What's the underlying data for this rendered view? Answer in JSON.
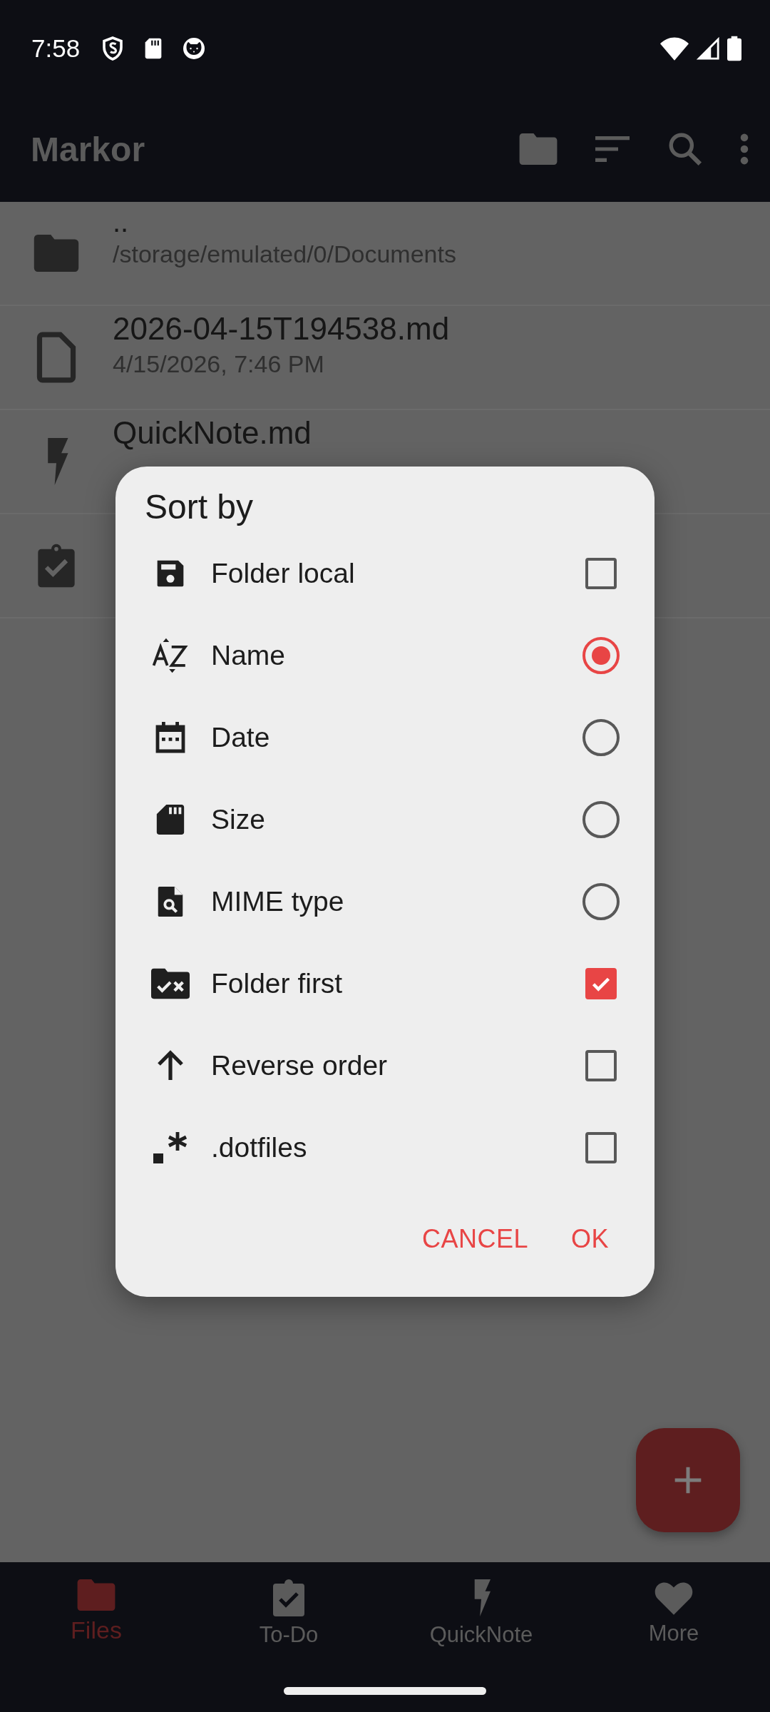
{
  "status_bar": {
    "time": "7:58"
  },
  "app_bar": {
    "title": "Markor"
  },
  "files": [
    {
      "name": "..",
      "detail": "/storage/emulated/0/Documents"
    },
    {
      "name": "2026-04-15T194538.md",
      "detail": "4/15/2026, 7:46 PM"
    },
    {
      "name": "QuickNote.md"
    }
  ],
  "dialog": {
    "title": "Sort by",
    "items": [
      {
        "label": "Folder local",
        "kind": "checkbox",
        "checked": false
      },
      {
        "label": "Name",
        "kind": "radio",
        "selected": true
      },
      {
        "label": "Date",
        "kind": "radio",
        "selected": false
      },
      {
        "label": "Size",
        "kind": "radio",
        "selected": false
      },
      {
        "label": "MIME type",
        "kind": "radio",
        "selected": false
      },
      {
        "label": "Folder first",
        "kind": "checkbox",
        "checked": true
      },
      {
        "label": "Reverse order",
        "kind": "checkbox",
        "checked": false
      },
      {
        "label": ".dotfiles",
        "kind": "checkbox",
        "checked": false
      }
    ],
    "buttons": [
      "CANCEL",
      "OK"
    ]
  },
  "bottom_nav": [
    {
      "label": "Files",
      "selected": true
    },
    {
      "label": "To-Do",
      "selected": false
    },
    {
      "label": "QuickNote",
      "selected": false
    },
    {
      "label": "More",
      "selected": false
    }
  ]
}
